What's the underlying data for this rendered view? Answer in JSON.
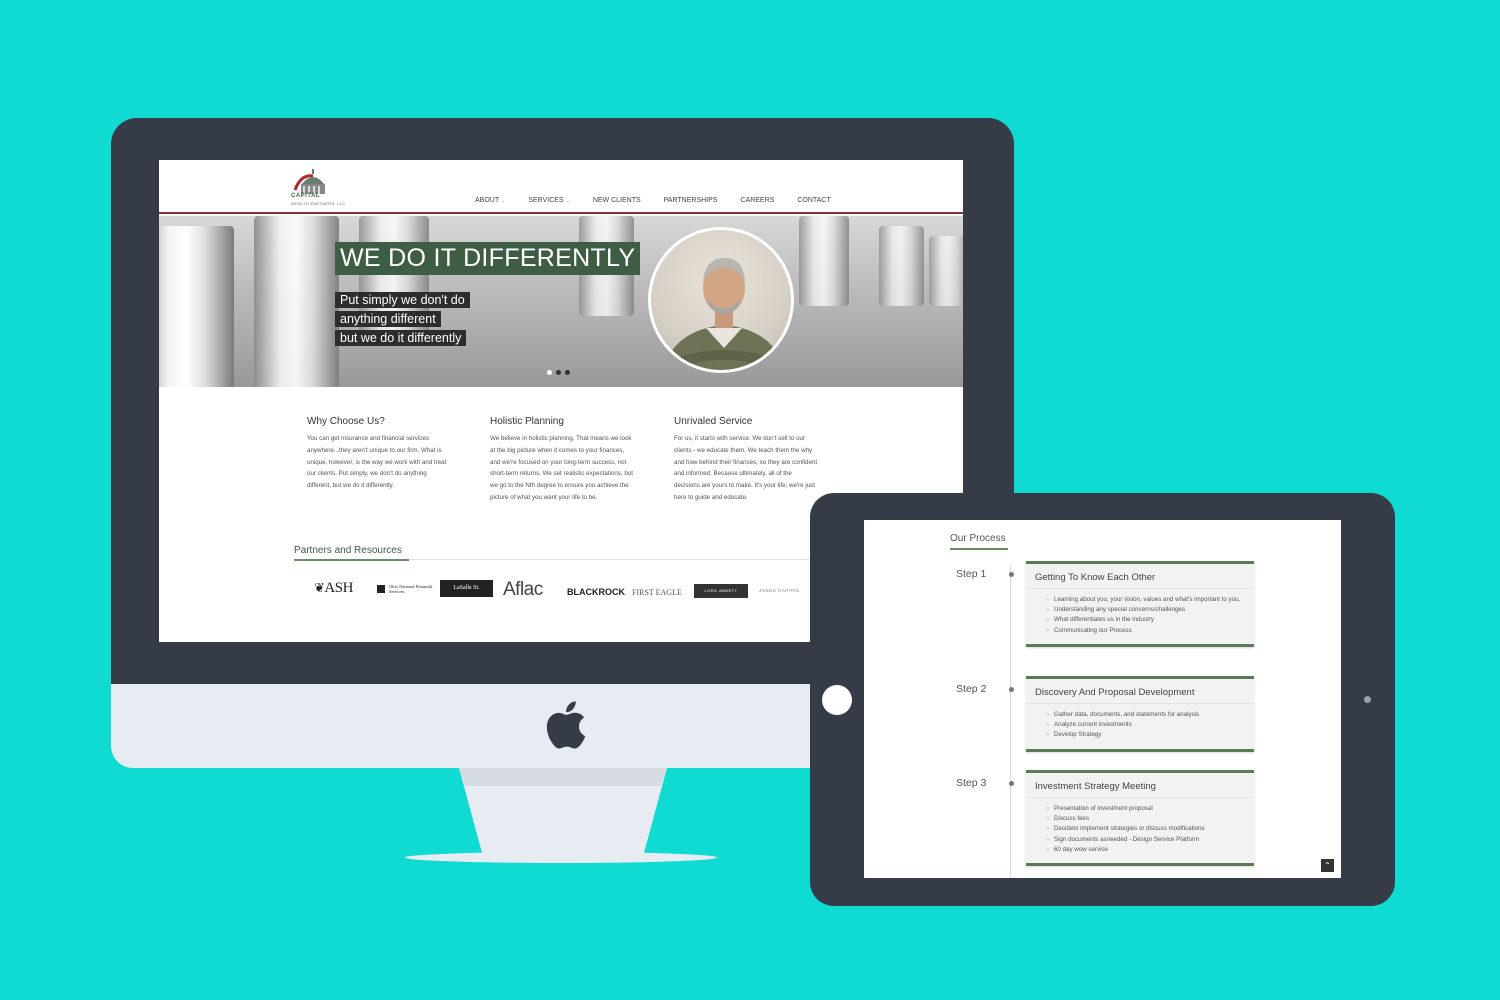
{
  "desktop": {
    "logo": {
      "name": "CAPITAL",
      "sub": "WEALTH PARTNERS, LLC"
    },
    "nav": [
      {
        "label": "ABOUT"
      },
      {
        "label": "SERVICES"
      },
      {
        "label": "NEW CLIENTS"
      },
      {
        "label": "PARTNERSHIPS"
      },
      {
        "label": "CAREERS"
      },
      {
        "label": "CONTACT"
      }
    ],
    "hero": {
      "title": "WE DO IT DIFFERENTLY",
      "lines": [
        "Put simply we don't do",
        "anything different",
        "but we do it differently"
      ]
    },
    "features": [
      {
        "title": "Why Choose Us?",
        "body": "You can get insurance and financial services anywhere...they aren't unique to our firm. What is unique, however, is the way we work with and treat our clients. Put simply, we don't do anything different, but we do it differently."
      },
      {
        "title": "Holistic Planning",
        "body": "We believe in holistic planning. That means we look at the big picture when it comes to your finances, and we're focused on your long-term success, not short-term returns. We set realistic expectations, but we go to the Nth degree to ensure you achieve the picture of what you want your life to be."
      },
      {
        "title": "Unrivaled Service",
        "body": "For us, it starts with service. We don't sell to our clients - we educate them. We teach them the why and how behind their finances, so they are confident and informed. Because ultimately, all of the decisions are yours to make. It's your life; we're just here to guide and educate."
      }
    ],
    "partners_title": "Partners and Resources",
    "partners": [
      "ASH",
      "Ohio National Financial Services",
      "LaSalle St.",
      "Aflac",
      "BLACKROCK",
      "FIRST EAGLE",
      "LORD ABBETT",
      "JANUS CAPITAL"
    ]
  },
  "tablet": {
    "process_title": "Our Process",
    "steps": [
      {
        "label": "Step 1",
        "title": "Getting To Know Each Other",
        "items": [
          "Learning about you, your vision, values and what's important to you.",
          "Understanding any special concerns/challenges",
          "What differentiates us in the industry",
          "Communicating our Process"
        ]
      },
      {
        "label": "Step 2",
        "title": "Discovery And Proposal Development",
        "items": [
          "Gather data, documents, and statements for analysis",
          "Analyze current investments",
          "Develop Strategy"
        ]
      },
      {
        "label": "Step 3",
        "title": "Investment Strategy Meeting",
        "items": [
          "Presentation of investment proposal",
          "Discuss fees",
          "Decideto implement strategies or discuss modifications",
          "Sign documents asneeded - Design Service Platform",
          "60 day wow service"
        ]
      }
    ]
  }
}
